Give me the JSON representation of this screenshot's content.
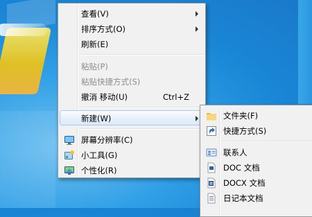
{
  "context_menu": {
    "items": [
      {
        "label": "查看(V)",
        "submenu": true
      },
      {
        "label": "排序方式(O)",
        "submenu": true
      },
      {
        "label": "刷新(E)"
      },
      {
        "label": "粘贴(P)",
        "disabled": true
      },
      {
        "label": "粘贴快捷方式(S)",
        "disabled": true
      },
      {
        "label": "撤消 移动(U)",
        "accelerator": "Ctrl+Z"
      },
      {
        "label": "新建(W)",
        "submenu": true,
        "highlighted": true
      },
      {
        "label": "屏幕分辨率(C)",
        "icon": "display-icon"
      },
      {
        "label": "小工具(G)",
        "icon": "gadgets-icon"
      },
      {
        "label": "个性化(R)",
        "icon": "personalize-icon"
      }
    ]
  },
  "submenu_new": {
    "items": [
      {
        "label": "文件夹(F)",
        "icon": "folder-icon"
      },
      {
        "label": "快捷方式(S)",
        "icon": "shortcut-icon"
      },
      {
        "label": "联系人",
        "icon": "contact-card-icon"
      },
      {
        "label": "DOC 文档",
        "icon": "doc-file-icon"
      },
      {
        "label": "DOCX 文档",
        "icon": "docx-file-icon"
      },
      {
        "label": "日记本文档",
        "icon": "journal-file-icon"
      }
    ]
  }
}
